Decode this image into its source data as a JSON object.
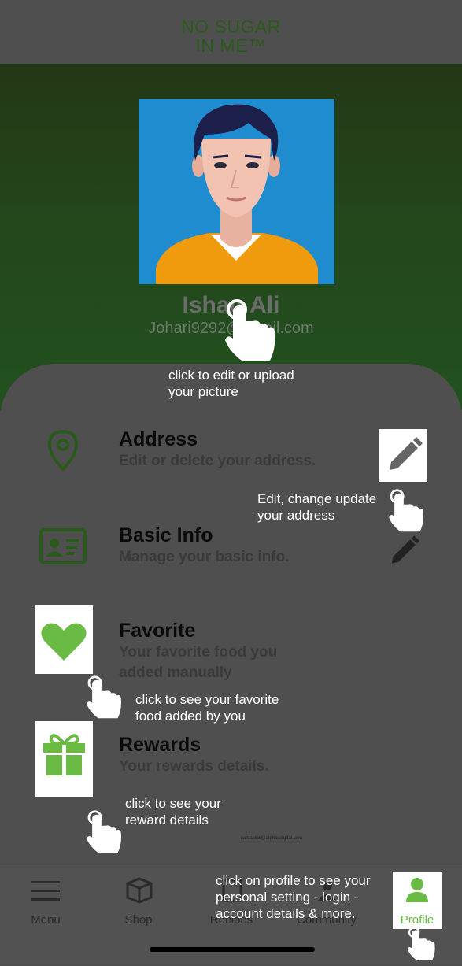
{
  "header": {
    "logo_line1": "NO SUGAR",
    "logo_line2": "IN ME™"
  },
  "profile": {
    "name": "Ishaq Ali",
    "email": "Johari9292@gmail.com",
    "picture_note": "click to edit or upload your picture"
  },
  "items": [
    {
      "title": "Address",
      "subtitle": "Edit or delete your address."
    },
    {
      "title": "Basic Info",
      "subtitle": "Manage your basic info."
    },
    {
      "title": "Favorite",
      "subtitle_line1": "Your favorite food you",
      "subtitle_line2": "added manually"
    },
    {
      "title": "Rewards",
      "subtitle": "Your rewards details."
    }
  ],
  "notes": {
    "address_l1": "Edit, change update",
    "address_l2": "your address",
    "favorite_l1": "click to see your favorite",
    "favorite_l2": "food added by you",
    "rewards_l1": "click to see your",
    "rewards_l2": "reward details",
    "profile_l1": "click on profile to see your",
    "profile_l2": "personal setting - login -",
    "profile_l3": "account details & more.",
    "picture_l1": "click to edit or upload",
    "picture_l2": "your picture"
  },
  "tiny_email": "contactus@alphasdigital.com",
  "nav": [
    {
      "label": "Menu",
      "icon": "menu-icon"
    },
    {
      "label": "Shop",
      "icon": "shop-icon"
    },
    {
      "label": "Recipes",
      "icon": "recipes-icon"
    },
    {
      "label": "Community",
      "icon": "community-icon"
    },
    {
      "label": "Profile",
      "icon": "profile-icon"
    }
  ],
  "colors": {
    "accent": "#6abb44",
    "dark_green": "#2a5a1b",
    "overlay": "#4f4f4f"
  }
}
